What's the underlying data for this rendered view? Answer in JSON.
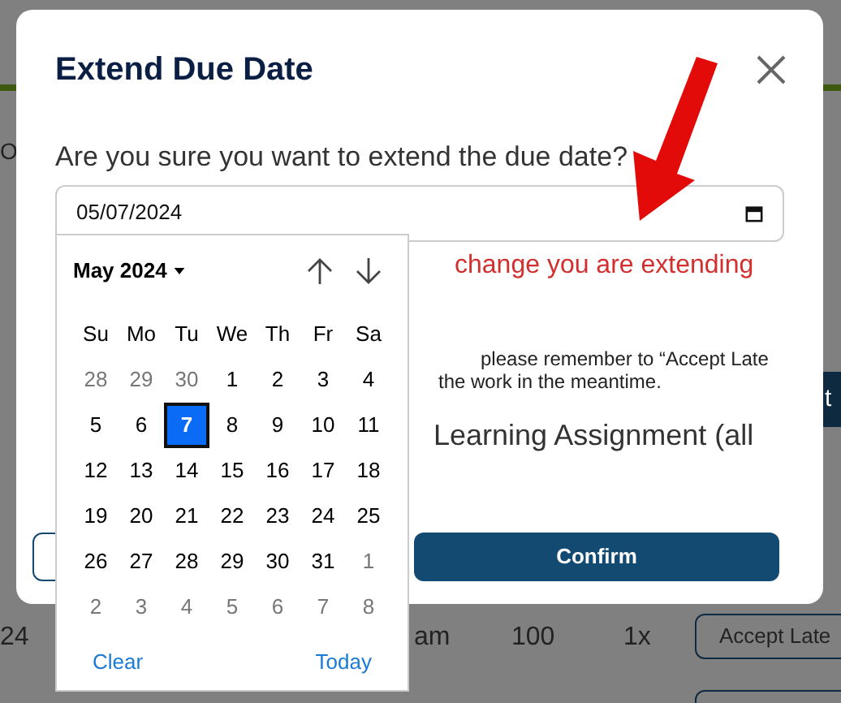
{
  "background_page": {
    "texts": [
      "O",
      "24",
      "am",
      "100",
      "1x"
    ],
    "buttons": [
      {
        "label": "t",
        "kind": "dark"
      },
      {
        "label": "Accept Late",
        "kind": "outline"
      }
    ]
  },
  "dialog": {
    "title": "Extend Due Date",
    "question": "Are you sure you want to extend the due date?",
    "date_field": {
      "value": "05/07/2024"
    },
    "warning": "change you are extending",
    "note_lines": [
      "please remember to “Accept Late",
      "the work in the meantime."
    ],
    "option_text": "Learning Assignment (all",
    "buttons": [
      {
        "kind": "outline"
      },
      {
        "kind": "primary",
        "label": "Confirm"
      }
    ]
  },
  "calendar": {
    "month_label": "May 2024",
    "weekdays": [
      "Su",
      "Mo",
      "Tu",
      "We",
      "Th",
      "Fr",
      "Sa"
    ],
    "weeks": [
      [
        {
          "label": "28",
          "outside": true,
          "selected": false
        },
        {
          "label": "29",
          "outside": true,
          "selected": false
        },
        {
          "label": "30",
          "outside": true,
          "selected": false
        },
        {
          "label": "1",
          "outside": false,
          "selected": false
        },
        {
          "label": "2",
          "outside": false,
          "selected": false
        },
        {
          "label": "3",
          "outside": false,
          "selected": false
        },
        {
          "label": "4",
          "outside": false,
          "selected": false
        }
      ],
      [
        {
          "label": "5",
          "outside": false,
          "selected": false
        },
        {
          "label": "6",
          "outside": false,
          "selected": false
        },
        {
          "label": "7",
          "outside": false,
          "selected": true
        },
        {
          "label": "8",
          "outside": false,
          "selected": false
        },
        {
          "label": "9",
          "outside": false,
          "selected": false
        },
        {
          "label": "10",
          "outside": false,
          "selected": false
        },
        {
          "label": "11",
          "outside": false,
          "selected": false
        }
      ],
      [
        {
          "label": "12",
          "outside": false,
          "selected": false
        },
        {
          "label": "13",
          "outside": false,
          "selected": false
        },
        {
          "label": "14",
          "outside": false,
          "selected": false
        },
        {
          "label": "15",
          "outside": false,
          "selected": false
        },
        {
          "label": "16",
          "outside": false,
          "selected": false
        },
        {
          "label": "17",
          "outside": false,
          "selected": false
        },
        {
          "label": "18",
          "outside": false,
          "selected": false
        }
      ],
      [
        {
          "label": "19",
          "outside": false,
          "selected": false
        },
        {
          "label": "20",
          "outside": false,
          "selected": false
        },
        {
          "label": "21",
          "outside": false,
          "selected": false
        },
        {
          "label": "22",
          "outside": false,
          "selected": false
        },
        {
          "label": "23",
          "outside": false,
          "selected": false
        },
        {
          "label": "24",
          "outside": false,
          "selected": false
        },
        {
          "label": "25",
          "outside": false,
          "selected": false
        }
      ],
      [
        {
          "label": "26",
          "outside": false,
          "selected": false
        },
        {
          "label": "27",
          "outside": false,
          "selected": false
        },
        {
          "label": "28",
          "outside": false,
          "selected": false
        },
        {
          "label": "29",
          "outside": false,
          "selected": false
        },
        {
          "label": "30",
          "outside": false,
          "selected": false
        },
        {
          "label": "31",
          "outside": false,
          "selected": false
        },
        {
          "label": "1",
          "outside": true,
          "selected": false
        }
      ],
      [
        {
          "label": "2",
          "outside": true,
          "selected": false
        },
        {
          "label": "3",
          "outside": true,
          "selected": false
        },
        {
          "label": "4",
          "outside": true,
          "selected": false
        },
        {
          "label": "5",
          "outside": true,
          "selected": false
        },
        {
          "label": "6",
          "outside": true,
          "selected": false
        },
        {
          "label": "7",
          "outside": true,
          "selected": false
        },
        {
          "label": "8",
          "outside": true,
          "selected": false
        }
      ]
    ],
    "footer": [
      "Clear",
      "Today"
    ]
  }
}
